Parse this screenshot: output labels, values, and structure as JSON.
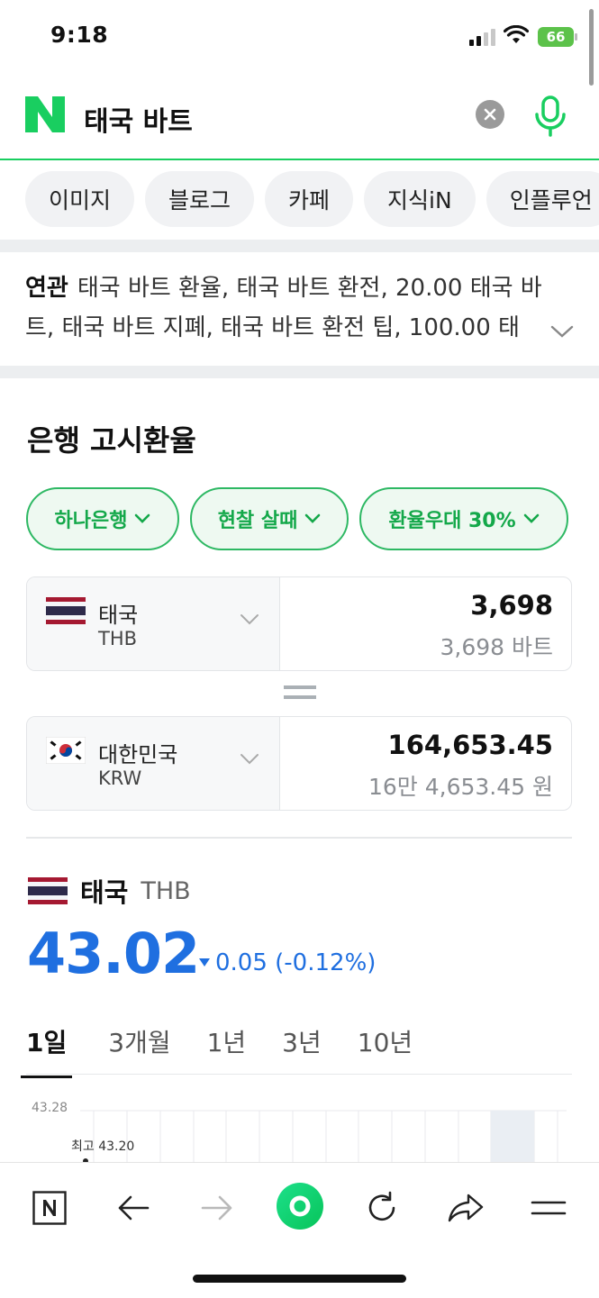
{
  "status": {
    "time": "9:18",
    "battery": "66"
  },
  "search": {
    "query": "태국 바트"
  },
  "tabs": [
    "이미지",
    "블로그",
    "카페",
    "지식iN",
    "인플루언"
  ],
  "related": {
    "label": "연관",
    "text": "태국 바트 환율, 태국 바트 환전, 20.00 태국 바트, 태국 바트 지폐, 태국 바트 환전 팁, 100.00 태"
  },
  "exchange": {
    "section_title": "은행 고시환율",
    "filters": [
      "하나은행",
      "현찰 살때",
      "환율우대 30%"
    ],
    "from": {
      "country": "태국",
      "code": "THB",
      "value": "3,698",
      "sub": "3,698 바트"
    },
    "to": {
      "country": "대한민국",
      "code": "KRW",
      "value": "164,653.45",
      "sub": "16만 4,653.45 원"
    }
  },
  "rate": {
    "country": "태국",
    "code": "THB",
    "value": "43.02",
    "change": "0.05 (-0.12%)",
    "direction": "down",
    "periods": [
      "1일",
      "3개월",
      "1년",
      "3년",
      "10년"
    ],
    "active_period": "1일"
  },
  "chart_data": {
    "type": "line",
    "y_ticks": [
      "43.28"
    ],
    "annotations": [
      "최고 43.20"
    ]
  },
  "toolbar": {
    "buttons": [
      "naver-home-icon",
      "back-icon",
      "forward-icon",
      "green-dot-icon",
      "refresh-icon",
      "share-icon",
      "menu-icon"
    ]
  },
  "colors": {
    "brand_green": "#19ce60",
    "rate_blue": "#1f6fe0"
  }
}
